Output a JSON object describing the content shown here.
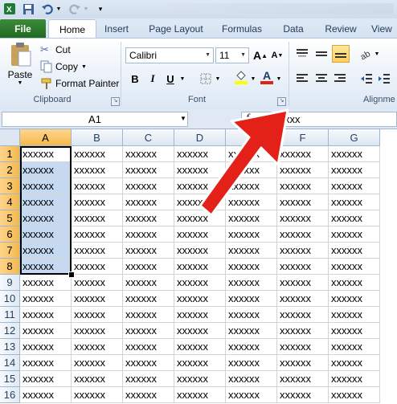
{
  "qat": {
    "icons": [
      "excel-logo-icon",
      "save-icon",
      "undo-icon",
      "redo-icon",
      "customize-icon"
    ]
  },
  "tabs": [
    {
      "label": "File"
    },
    {
      "label": "Home"
    },
    {
      "label": "Insert"
    },
    {
      "label": "Page Layout"
    },
    {
      "label": "Formulas"
    },
    {
      "label": "Data"
    },
    {
      "label": "Review"
    },
    {
      "label": "View"
    }
  ],
  "clipboard": {
    "paste": "Paste",
    "cut": "Cut",
    "copy": "Copy",
    "format_painter": "Format Painter",
    "group_label": "Clipboard"
  },
  "font": {
    "name": "Calibri",
    "size": "11",
    "bold": "B",
    "italic": "I",
    "underline": "U",
    "font_color_letter": "A",
    "grow": "A",
    "shrink": "A",
    "group_label": "Font"
  },
  "alignment": {
    "group_label": "Alignme"
  },
  "formula_bar": {
    "name_box": "A1",
    "fx": "f",
    "value": "xxxxx"
  },
  "grid": {
    "columns": [
      "A",
      "B",
      "C",
      "D",
      "E",
      "F",
      "G"
    ],
    "rows": [
      "1",
      "2",
      "3",
      "4",
      "5",
      "6",
      "7",
      "8",
      "9",
      "10",
      "11",
      "12",
      "13",
      "14",
      "15",
      "16"
    ],
    "cell_value": "xxxxxx",
    "selected_column": "A",
    "selected_rows": "1-8",
    "active_cell": "A1"
  },
  "colors": {
    "file_tab": "#1f6b21",
    "selection": "#c5d9f1",
    "header_selected": "#f4b94c",
    "arrow": "#e32119"
  }
}
